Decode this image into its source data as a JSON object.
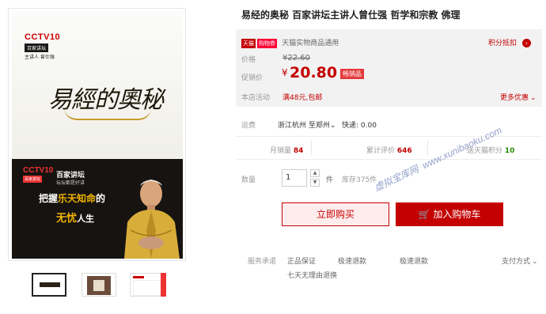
{
  "title": "易经的奥秘 百家讲坛主讲人曾仕强 哲学和宗教 佛理",
  "cover": {
    "top_logo": "CCTV10",
    "top_sub": "百家讲坛",
    "top_author": "主讲人 曾仕强",
    "calligraphy": "易經的奧秘",
    "bottom_logo": "CCTV10",
    "bottom_logo_sub": "百家讲坛",
    "bottom_program": "百家讲坛",
    "bottom_program_sub": "坛坛都是好讲",
    "slogan_line1_pre": "把握",
    "slogan_line1_em": "乐天知命",
    "slogan_line1_post": "的",
    "slogan_line2_em": "无忧",
    "slogan_line2_post": "人生"
  },
  "promo": {
    "tmall_tag": "天猫",
    "coupon_tag": "购物券",
    "coupon_text": "天猫实物商品通用",
    "points_text": "积分抵扣"
  },
  "price": {
    "label": "价格",
    "original": "¥22.60",
    "promo_label": "促销价",
    "currency": "¥",
    "current": "20.80",
    "hot_tag": "畅销品"
  },
  "store_activity": {
    "label": "本店活动",
    "text": "满48元,包邮",
    "more": "更多优惠"
  },
  "shipping": {
    "label": "运费",
    "text": "浙江杭州 至郑州",
    "express": "快递: 0.00"
  },
  "stats": {
    "monthly_label": "月销量",
    "monthly": "84",
    "reviews_label": "累计评价",
    "reviews": "646",
    "points_label": "送天猫积分",
    "points": "10"
  },
  "quantity": {
    "label": "数量",
    "value": "1",
    "unit": "件",
    "stock": "库存375件"
  },
  "buttons": {
    "buy": "立即购买",
    "cart": "加入购物车"
  },
  "watermark": {
    "cn": "虚拟宝库网",
    "url": "www.xunibaoku.com"
  },
  "services": {
    "label": "服务承诺",
    "items": [
      "正品保证",
      "极速退款",
      "极速退款",
      "七天无理由退换"
    ],
    "payment": "支付方式"
  }
}
